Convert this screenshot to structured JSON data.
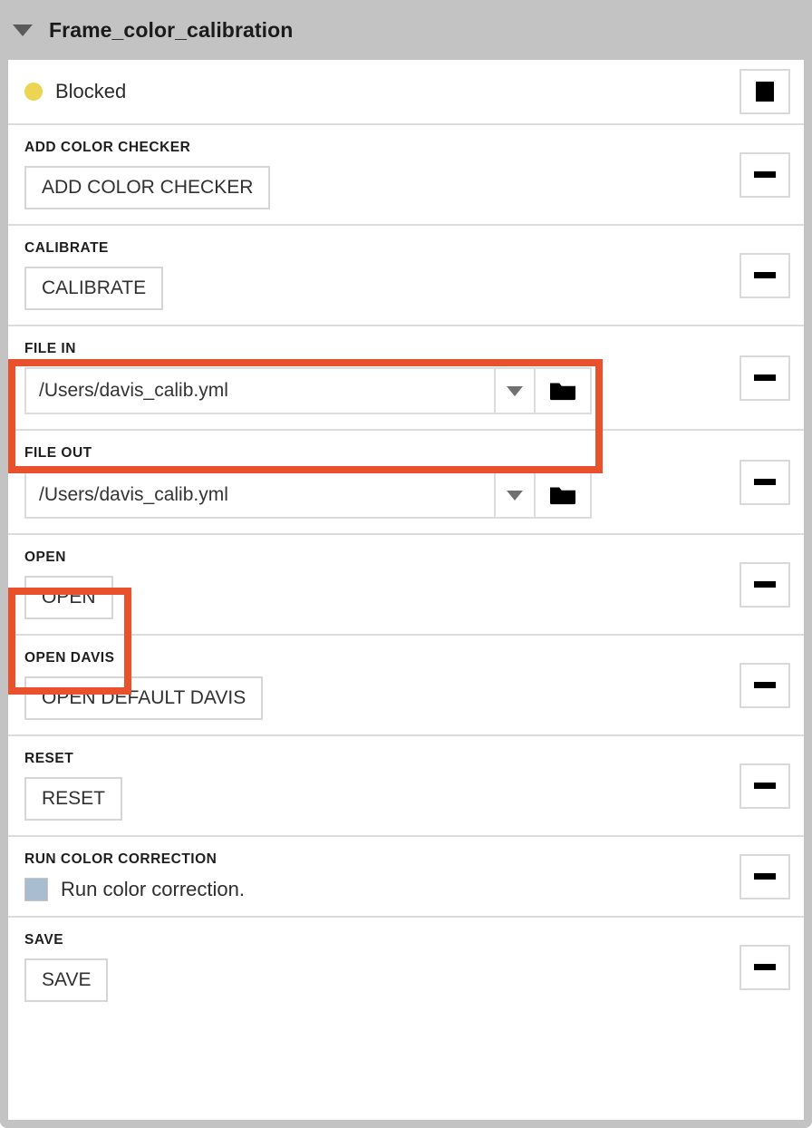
{
  "header": {
    "title": "Frame_color_calibration",
    "disclosure_icon": "triangle-down-icon",
    "background": "#c3c3c3"
  },
  "status": {
    "label": "Blocked",
    "dot_color": "#ebd552",
    "stop_button_icon": "stop-square-icon"
  },
  "aside_button_icon": "minus-icon",
  "highlight_color": "#e8512b",
  "sections": [
    {
      "label": "ADD COLOR CHECKER",
      "button_label": "ADD COLOR CHECKER"
    },
    {
      "label": "CALIBRATE",
      "button_label": "CALIBRATE"
    },
    {
      "label": "FILE IN",
      "value": "/Users/davis_calib.yml",
      "dropdown_icon": "chevron-down-icon",
      "browse_icon": "folder-icon",
      "highlighted": true
    },
    {
      "label": "FILE OUT",
      "value": "/Users/davis_calib.yml",
      "dropdown_icon": "chevron-down-icon",
      "browse_icon": "folder-icon",
      "highlighted": false
    },
    {
      "label": "OPEN",
      "button_label": "OPEN",
      "highlighted": true
    },
    {
      "label": "OPEN DAVIS",
      "button_label": "OPEN DEFAULT DAVIS"
    },
    {
      "label": "RESET",
      "button_label": "RESET"
    },
    {
      "label": "RUN COLOR CORRECTION",
      "checkbox_label": "Run color correction.",
      "checkbox_checked": true,
      "checkbox_color": "#a9bdd0"
    },
    {
      "label": "SAVE",
      "button_label": "SAVE"
    }
  ]
}
